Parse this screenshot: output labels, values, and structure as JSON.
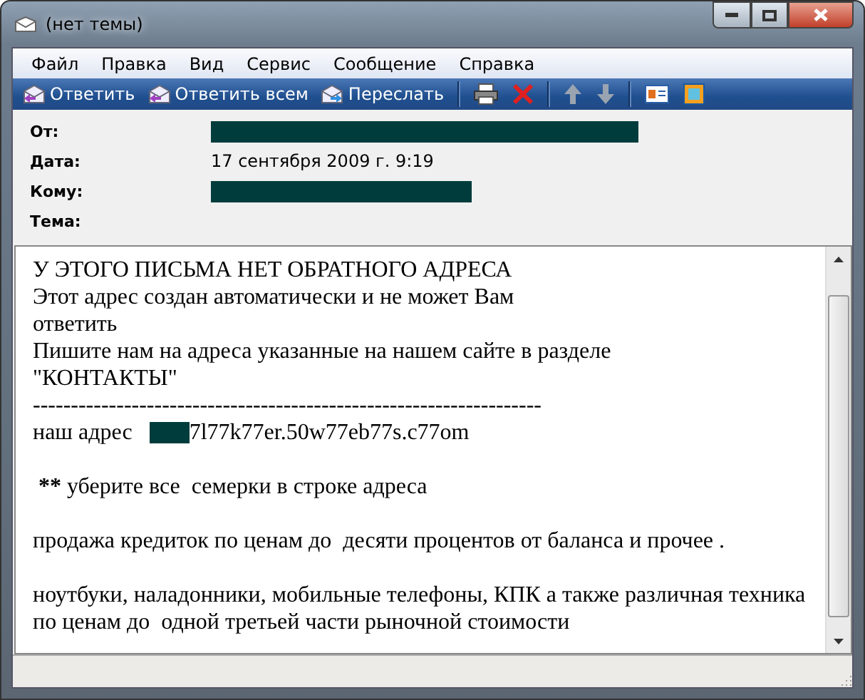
{
  "window": {
    "title": "(нет темы)"
  },
  "menu": [
    "Файл",
    "Правка",
    "Вид",
    "Сервис",
    "Сообщение",
    "Справка"
  ],
  "toolbar": [
    {
      "kind": "reply",
      "label": "Ответить"
    },
    {
      "kind": "reply-all",
      "label": "Ответить всем"
    },
    {
      "kind": "forward",
      "label": "Переслать"
    },
    {
      "kind": "separator"
    },
    {
      "kind": "print"
    },
    {
      "kind": "delete"
    },
    {
      "kind": "separator"
    },
    {
      "kind": "up"
    },
    {
      "kind": "down"
    },
    {
      "kind": "separator"
    },
    {
      "kind": "contact"
    },
    {
      "kind": "encoding"
    }
  ],
  "header": [
    {
      "label": "От:",
      "redacted": true
    },
    {
      "label": "Дата:",
      "value": "17 сентября 2009 г. 9:19"
    },
    {
      "label": "Кому:",
      "redacted": true
    },
    {
      "label": "Тема:"
    }
  ],
  "body": [
    {
      "kind": "text",
      "text": "У ЭТОГО ПИСЬМА НЕТ ОБРАТНОГО АДРЕСА"
    },
    {
      "kind": "text",
      "text": "Этот адрес создан автоматически и не может Вам"
    },
    {
      "kind": "text",
      "text": "ответить"
    },
    {
      "kind": "text",
      "text": "Пишите нам на адреса указанные на нашем сайте в разделе"
    },
    {
      "kind": "text",
      "text": "\"КОНТАКТЫ\""
    },
    {
      "kind": "text",
      "text": "-------------------------------------------------------------------"
    },
    {
      "kind": "address",
      "text": "наш адрес",
      "value": "7l77k77er.50w77eb77s.c77om"
    },
    {
      "kind": "blank"
    },
    {
      "kind": "note",
      "mark": "**",
      "text": "уберите все  семерки в строке адреса"
    },
    {
      "kind": "blank"
    },
    {
      "kind": "text",
      "text": "продажа кредиток по ценам до  десяти процентов от баланса и прочее ."
    },
    {
      "kind": "blank"
    },
    {
      "kind": "text",
      "text": "ноутбуки, наладонники, мобильные телефоны, КПК а также различная техника"
    },
    {
      "kind": "text",
      "text": "по ценам до  одной третьей части рыночной стоимости"
    }
  ]
}
